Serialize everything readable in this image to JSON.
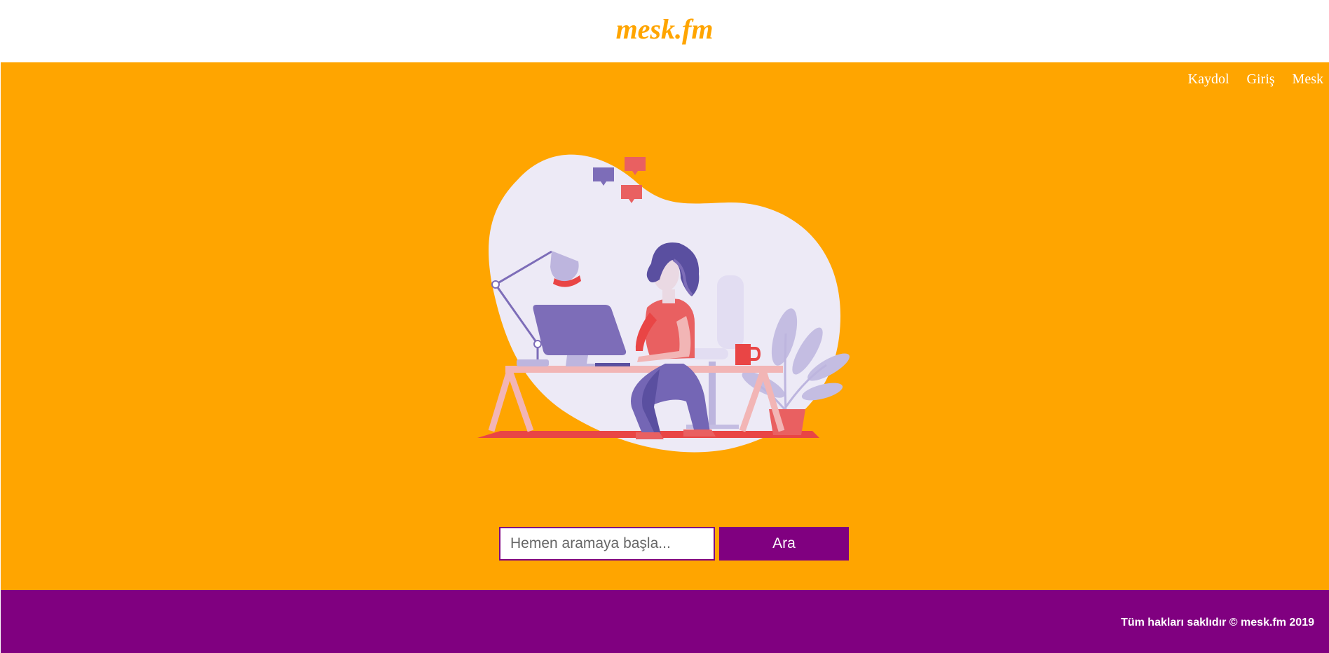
{
  "header": {
    "brand": "mesk.fm"
  },
  "nav": {
    "items": [
      {
        "label": "Kaydol"
      },
      {
        "label": "Giriş"
      },
      {
        "label": "Mesk"
      }
    ]
  },
  "search": {
    "placeholder": "Hemen aramaya başla...",
    "value": "",
    "button_label": "Ara"
  },
  "footer": {
    "copyright": "Tüm hakları saklıdır © mesk.fm 2019"
  },
  "colors": {
    "accent": "#FFA500",
    "brand_purple": "#800080"
  },
  "illustration": {
    "subject": "woman-at-desk-with-computer"
  }
}
